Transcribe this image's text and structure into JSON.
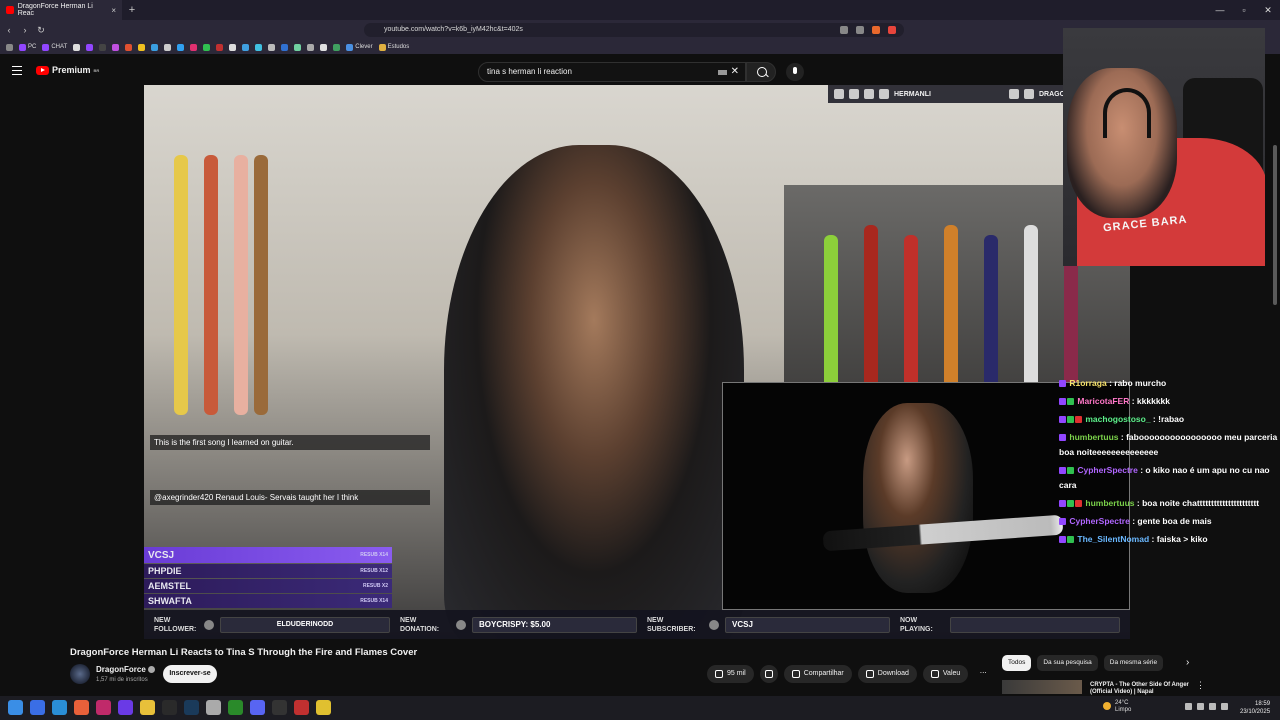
{
  "browser": {
    "tab_title": "DragonForce Herman Li Reac",
    "url": "youtube.com/watch?v=k6b_iyM42hc&t=402s",
    "bookmarks": [
      "PC",
      "CHAT",
      "Clever",
      "Estudos"
    ]
  },
  "youtube": {
    "brand": "Premium",
    "brand_sup": "BR",
    "search_value": "tina s herman li reaction"
  },
  "stream_overlay": {
    "top_social_handle": "HERMANLI",
    "top_social_handle2": "DRAGO",
    "chat_left": [
      "This is the first song I learned on guitar.",
      "@axegrinder420 Renaud Louis- Servais taught her I think"
    ],
    "subs": [
      {
        "name": "VCSJ",
        "tag": "RESUB X14"
      },
      {
        "name": "PHPDIE",
        "tag": "RESUB X12"
      },
      {
        "name": "AEMSTEL",
        "tag": "RESUB X2"
      },
      {
        "name": "SHWAFTA",
        "tag": "RESUB X14"
      }
    ],
    "bar": {
      "follower_label": "NEW FOLLOWER:",
      "follower_value": "ELDUDERINODD",
      "donation_label": "NEW DONATION:",
      "donation_value": "BOYCRISPY: $5.00",
      "subscriber_label": "NEW SUBSCRIBER:",
      "subscriber_value": "VCSJ",
      "now_playing_label": "NOW PLAYING:",
      "now_playing_value": ""
    }
  },
  "webcam": {
    "shirt_text": "GRACE BARA"
  },
  "chat_right": [
    {
      "user": "R1orraga",
      "color": "#f5e06a",
      "msg": "rabo murcho"
    },
    {
      "user": "MaricotaFER",
      "color": "#ff77c8",
      "msg": "kkkkkkk"
    },
    {
      "user": "machogostoso_",
      "color": "#5cf08a",
      "msg": "!rabao"
    },
    {
      "user": "humbertuus",
      "color": "#7ad04a",
      "msg": "faboooooooooooooooo meu parceria boa noiteeeeeeeeeeeeee"
    },
    {
      "user": "CypherSpectre",
      "color": "#b066ff",
      "msg": "o kiko nao é um apu no cu nao cara"
    },
    {
      "user": "humbertuus",
      "color": "#7ad04a",
      "msg": "boa noite chatttttttttttttttttttttt"
    },
    {
      "user": "CypherSpectre",
      "color": "#b066ff",
      "msg": "gente boa de mais"
    },
    {
      "user": "The_SilentNomad",
      "color": "#6ab8ff",
      "msg": "faiska > kiko"
    }
  ],
  "video": {
    "title": "DragonForce Herman Li Reacts to Tina S Through the Fire and Flames Cover",
    "channel": "DragonForce",
    "subscribers": "1,57 mi de inscritos",
    "subscribe_label": "Inscrever-se",
    "likes": "95 mil",
    "share_label": "Compartilhar",
    "download_label": "Download",
    "thanks_label": "Valeu"
  },
  "sidebar": {
    "chips": [
      "Todos",
      "Da sua pesquisa",
      "Da mesma série"
    ],
    "rec_title": "CRYPTA - The Other Side Of Anger (Official Video) | Napal"
  },
  "taskbar": {
    "temp": "24°C",
    "weather": "Limpo",
    "time": "18:59",
    "date": "23/10/2025"
  }
}
